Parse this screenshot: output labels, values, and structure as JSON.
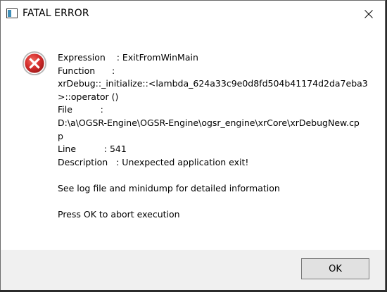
{
  "window": {
    "title": "FATAL ERROR",
    "icon": "window-app-icon",
    "close_icon": "close-icon"
  },
  "message": {
    "lines": [
      "Expression    : ExitFromWinMain",
      "Function      :",
      "xrDebug::_initialize::<lambda_624a33c9e0d8fd504b41174d2da7eba3",
      ">::operator ()",
      "File          :",
      "D:\\a\\OGSR-Engine\\OGSR-Engine\\ogsr_engine\\xrCore\\xrDebugNew.cp",
      "p",
      "Line          : 541",
      "Description   : Unexpected application exit!",
      "",
      "See log file and minidump for detailed information",
      "",
      "Press OK to abort execution"
    ]
  },
  "buttons": {
    "ok_label": "OK"
  },
  "colors": {
    "error_red": "#d42d2d",
    "footer_bg": "#f0f0f0",
    "button_bg": "#e1e1e1"
  }
}
